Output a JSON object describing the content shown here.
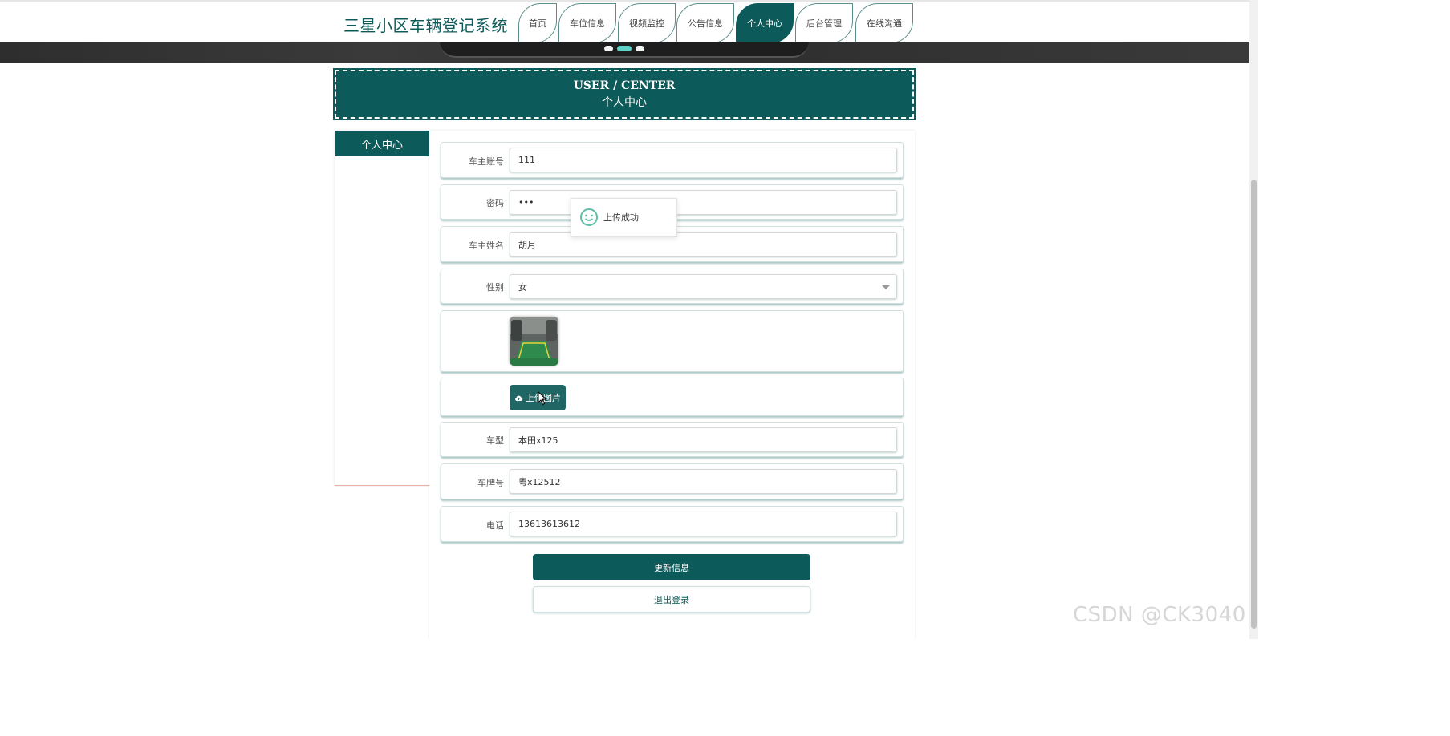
{
  "site": {
    "title": "三星小区车辆登记系统"
  },
  "nav": {
    "items": [
      {
        "label": "首页"
      },
      {
        "label": "车位信息"
      },
      {
        "label": "视频监控"
      },
      {
        "label": "公告信息"
      },
      {
        "label": "个人中心"
      },
      {
        "label": "后台管理"
      },
      {
        "label": "在线沟通"
      }
    ],
    "active_index": 4
  },
  "banner": {
    "slide_count": 3,
    "active_slide": 2
  },
  "section": {
    "title_en": "USER / CENTER",
    "title_zh": "个人中心"
  },
  "sidebar": {
    "items": [
      {
        "label": "个人中心"
      }
    ]
  },
  "form": {
    "account": {
      "label": "车主账号",
      "value": "111"
    },
    "password": {
      "label": "密码",
      "value": "•••"
    },
    "name": {
      "label": "车主姓名",
      "value": "胡月"
    },
    "gender": {
      "label": "性别",
      "value": "女"
    },
    "upload_label": "上传图片",
    "car_model": {
      "label": "车型",
      "value": "本田x125"
    },
    "plate": {
      "label": "车牌号",
      "value": "粤x12512"
    },
    "phone": {
      "label": "电话",
      "value": "13613613612"
    }
  },
  "actions": {
    "update": "更新信息",
    "logout": "退出登录"
  },
  "toast": {
    "message": "上传成功"
  },
  "watermark": "CSDN @CK3040",
  "colors": {
    "primary": "#0c5b5a",
    "accent": "#5fd1c6"
  }
}
